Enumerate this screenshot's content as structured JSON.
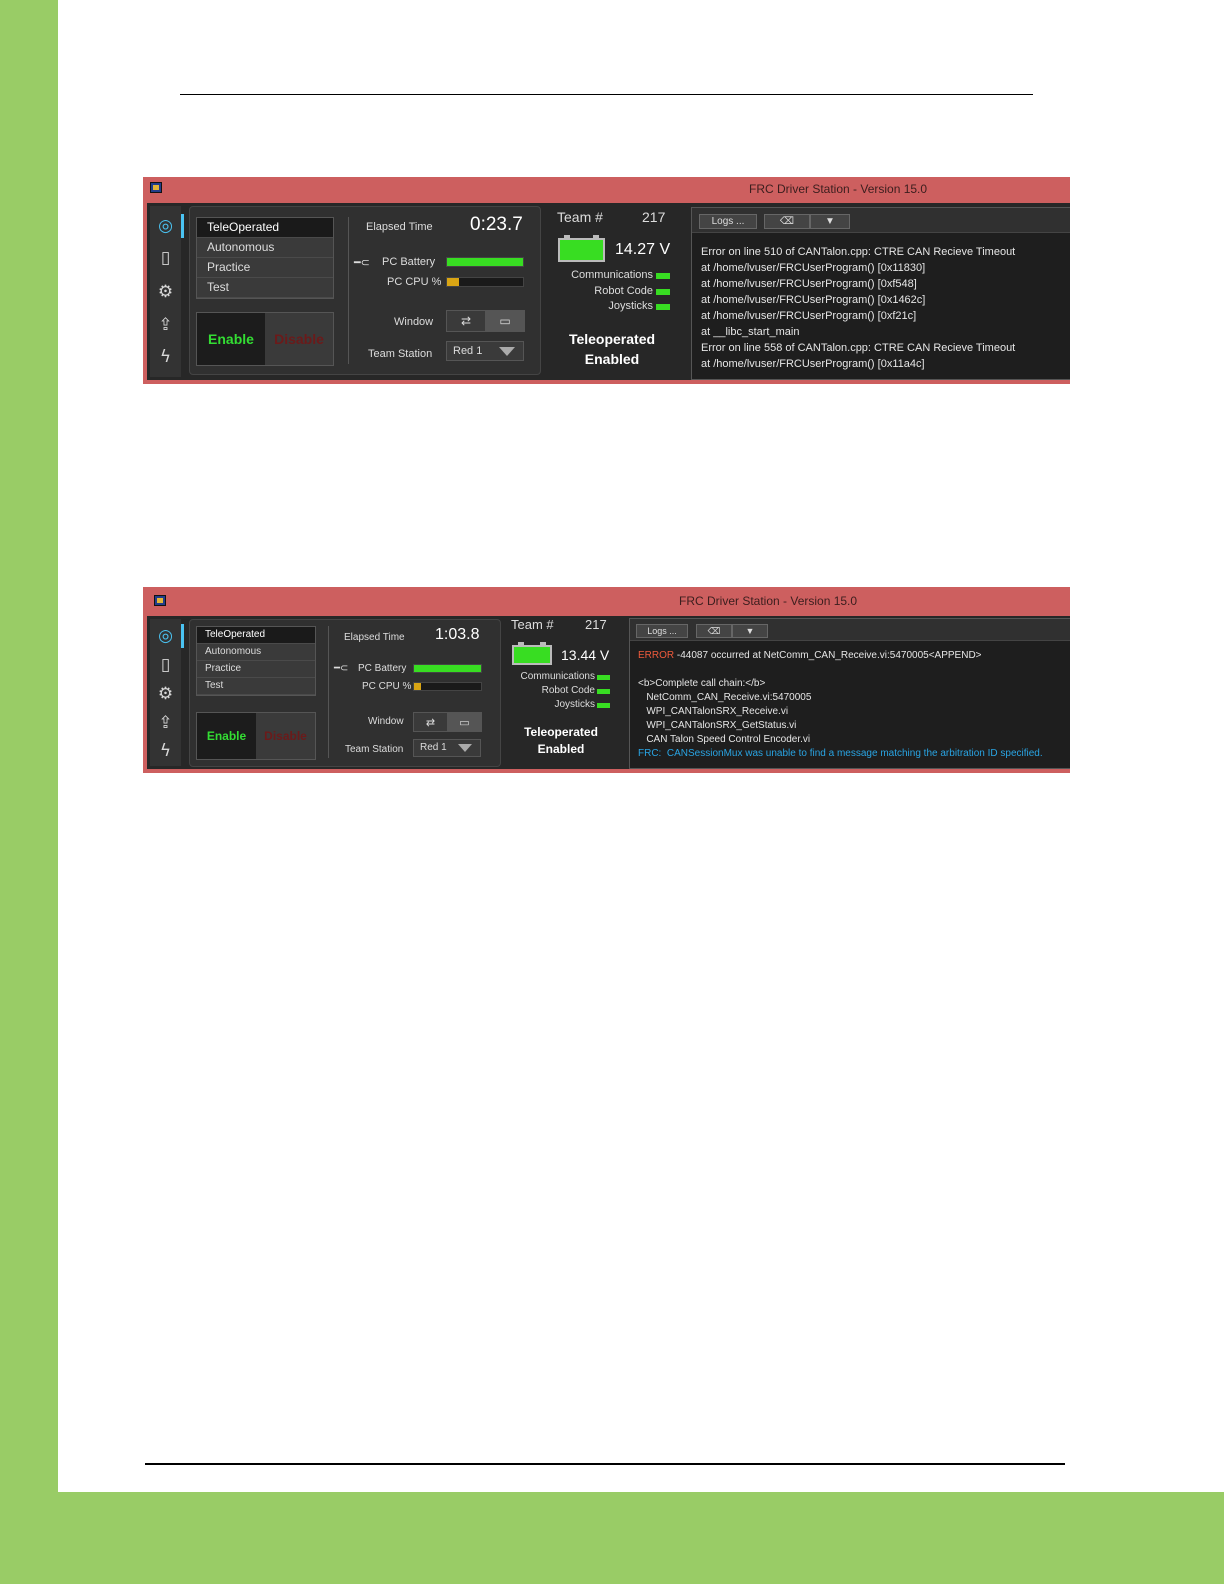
{
  "screens": [
    {
      "title": "FRC Driver Station - Version 15.0",
      "modes": [
        "TeleOperated",
        "Autonomous",
        "Practice",
        "Test"
      ],
      "enable_label": "Enable",
      "disable_label": "Disable",
      "elapsed_label": "Elapsed Time",
      "elapsed_value": "0:23.7",
      "pc_battery_label": "PC Battery",
      "pc_battery_level": 1.0,
      "pc_cpu_label": "PC CPU %",
      "pc_cpu_level": 0.16,
      "window_label": "Window",
      "team_station_label": "Team Station",
      "team_station_value": "Red 1",
      "team_label": "Team #",
      "team_number": "217",
      "voltage": "14.27 V",
      "indicators": [
        "Communications",
        "Robot Code",
        "Joysticks"
      ],
      "status_line1": "Teleoperated",
      "status_line2": "Enabled",
      "logs_button": "Logs ...",
      "log_lines": [
        {
          "text": "Error on line 510 of CANTalon.cpp: CTRE CAN Recieve Timeout"
        },
        {
          "text": " at /home/lvuser/FRCUserProgram() [0x11830]"
        },
        {
          "text": " at /home/lvuser/FRCUserProgram() [0xf548]"
        },
        {
          "text": " at /home/lvuser/FRCUserProgram() [0x1462c]"
        },
        {
          "text": " at /home/lvuser/FRCUserProgram() [0xf21c]"
        },
        {
          "text": " at __libc_start_main"
        },
        {
          "text": "Error on line 558 of CANTalon.cpp: CTRE CAN Recieve Timeout"
        },
        {
          "text": " at /home/lvuser/FRCUserProgram() [0x11a4c]"
        }
      ]
    },
    {
      "title": "FRC Driver Station - Version 15.0",
      "modes": [
        "TeleOperated",
        "Autonomous",
        "Practice",
        "Test"
      ],
      "enable_label": "Enable",
      "disable_label": "Disable",
      "elapsed_label": "Elapsed Time",
      "elapsed_value": "1:03.8",
      "pc_battery_label": "PC Battery",
      "pc_battery_level": 1.0,
      "pc_cpu_label": "PC CPU %",
      "pc_cpu_level": 0.1,
      "window_label": "Window",
      "team_station_label": "Team Station",
      "team_station_value": "Red 1",
      "team_label": "Team #",
      "team_number": "217",
      "voltage": "13.44 V",
      "indicators": [
        "Communications",
        "Robot Code",
        "Joysticks"
      ],
      "status_line1": "Teleoperated",
      "status_line2": "Enabled",
      "logs_button": "Logs ...",
      "log_error_tag": "ERROR",
      "log_error_rest": "-44087 occurred at NetComm_CAN_Receive.vi:5470005<APPEND>",
      "log_lines2": [
        "<b>Complete call chain:</b>",
        "   NetComm_CAN_Receive.vi:5470005",
        "   WPI_CANTalonSRX_Receive.vi",
        "   WPI_CANTalonSRX_GetStatus.vi",
        "   CAN Talon Speed Control Encoder.vi"
      ],
      "log_info": "FRC:  CANSessionMux was unable to find a message matching the arbitration ID specified."
    }
  ],
  "colors": {
    "page_green": "#99cc66",
    "titlebar_red": "#cd5f5f",
    "ok_green": "#38dd22",
    "cpu_yellow": "#d9a514",
    "accent_blue": "#4ac3f2"
  }
}
